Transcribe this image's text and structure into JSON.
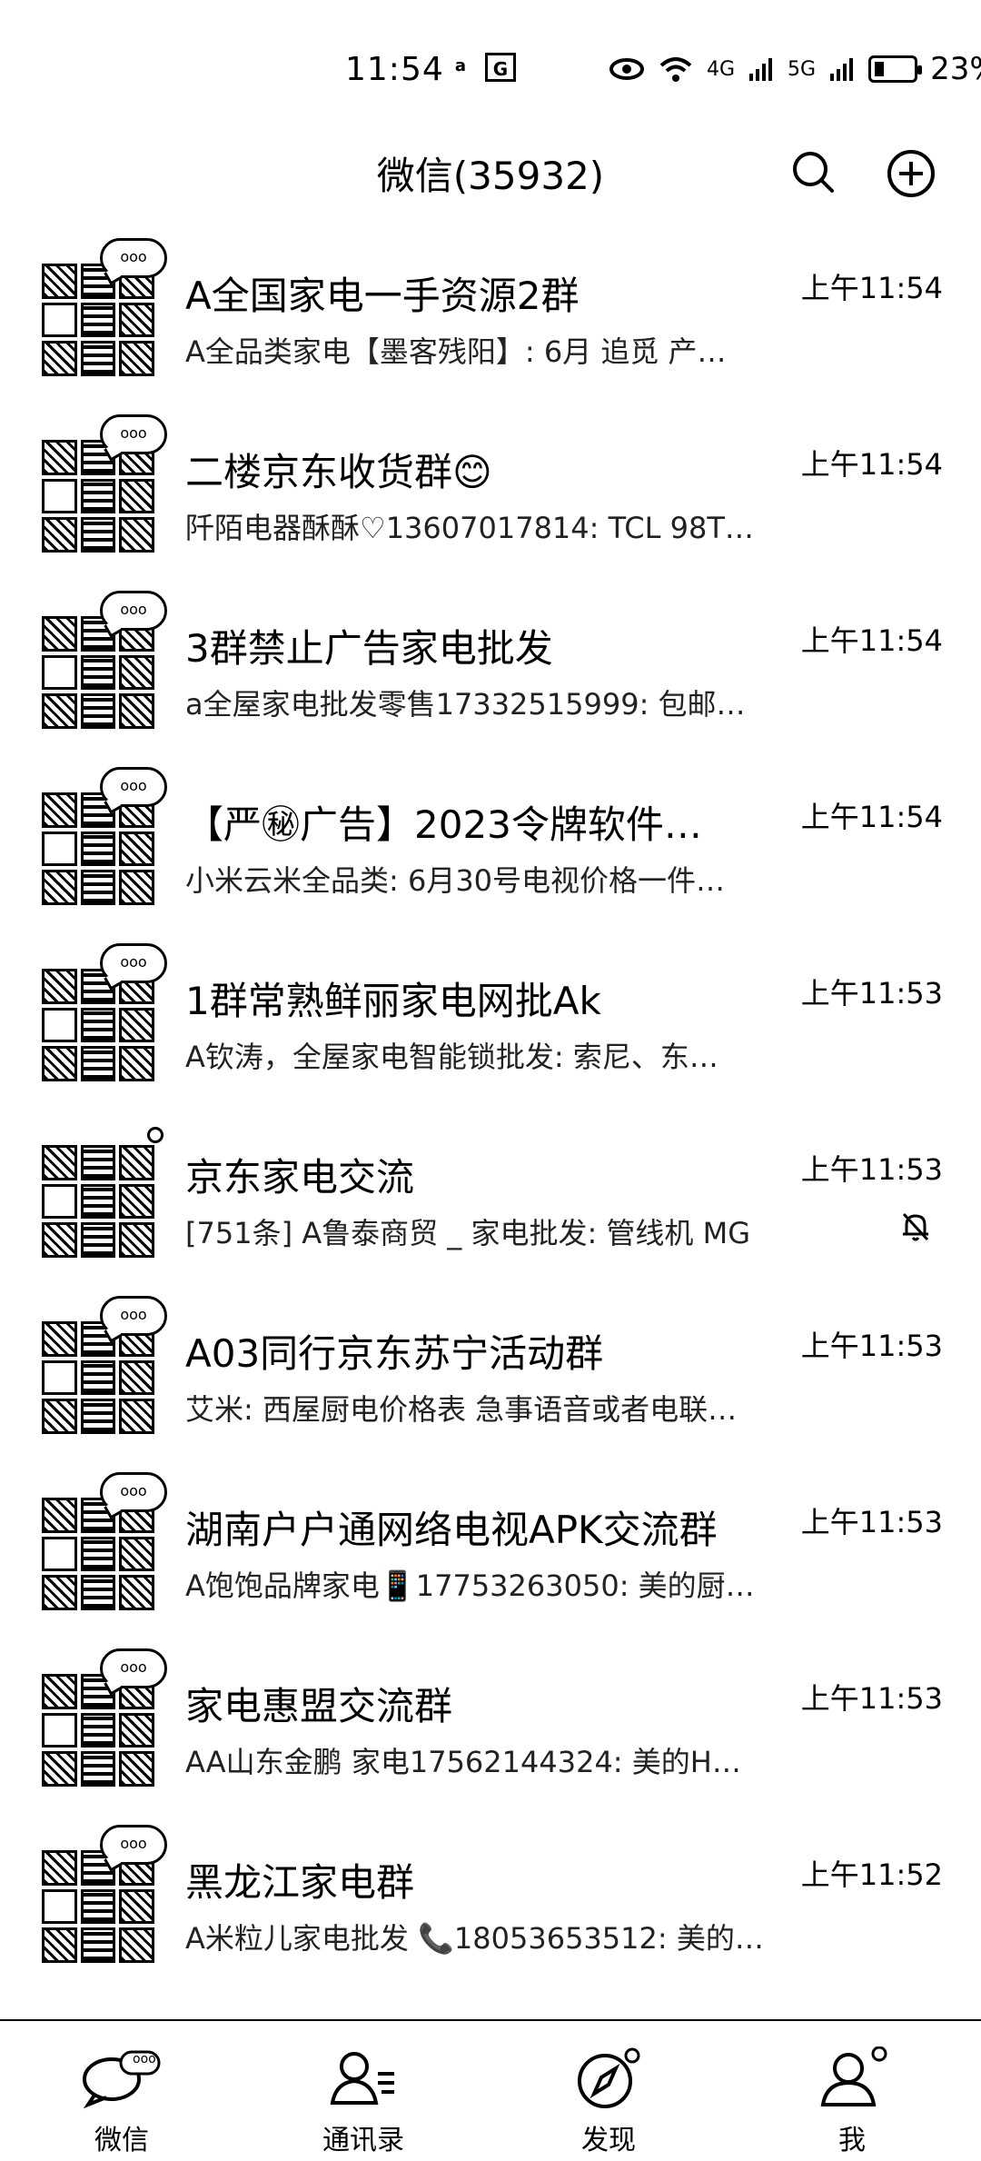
{
  "status_bar": {
    "time": "11:54",
    "icon_left_1": "a",
    "icon_left_2": "G",
    "net1": "4G",
    "net2": "5G",
    "battery_level": 0.23,
    "battery_pct": "23%"
  },
  "header": {
    "title": "微信(35932)"
  },
  "chats": [
    {
      "name": "A全国家电一手资源2群",
      "message": "A全品类家电【墨客残阳】: 6月 追觅 产…",
      "time": "上午11:54",
      "badge": "ooo",
      "muted": false
    },
    {
      "name": "二楼京东收货群😊",
      "message": "阡陌电器酥酥♡13607017814: TCL 98T…",
      "time": "上午11:54",
      "badge": "ooo",
      "muted": false
    },
    {
      "name": "3群禁止广告家电批发",
      "message": "a全屋家电批发零售17332515999:  包邮…",
      "time": "上午11:54",
      "badge": "ooo",
      "muted": false
    },
    {
      "name": "【严㊙广告】2023令牌软件…",
      "message": "小米云米全品类: 6月30号电视价格一件…",
      "time": "上午11:54",
      "badge": "ooo",
      "muted": false
    },
    {
      "name": "1群常熟鲜丽家电网批Ak",
      "message": "A钦涛，全屋家电智能锁批发: 索尼、东…",
      "time": "上午11:53",
      "badge": "ooo",
      "muted": false
    },
    {
      "name": "京东家电交流",
      "message": "[751条] A鲁泰商贸 _ 家电批发: 管线机 MG",
      "time": "上午11:53",
      "badge": "",
      "muted": true
    },
    {
      "name": "A03同行京东苏宁活动群",
      "message": "艾米: 西屋厨电价格表 急事语音或者电联…",
      "time": "上午11:53",
      "badge": "ooo",
      "muted": false
    },
    {
      "name": "湖南户户通网络电视APK交流群",
      "message": "A饱饱品牌家电📱17753263050: 美的厨…",
      "time": "上午11:53",
      "badge": "ooo",
      "muted": false
    },
    {
      "name": "家电惠盟交流群",
      "message": "AA山东金鹏 家电17562144324:   美的H…",
      "time": "上午11:53",
      "badge": "ooo",
      "muted": false
    },
    {
      "name": "黑龙江家电群",
      "message": "A米粒儿家电批发 📞18053653512: 美的…",
      "time": "上午11:52",
      "badge": "ooo",
      "muted": false
    }
  ],
  "nav": {
    "tabs": [
      {
        "label": "微信",
        "icon": "chat-bubble-icon",
        "badge": "ooo"
      },
      {
        "label": "通讯录",
        "icon": "contacts-icon"
      },
      {
        "label": "发现",
        "icon": "compass-icon"
      },
      {
        "label": "我",
        "icon": "person-icon"
      }
    ]
  }
}
